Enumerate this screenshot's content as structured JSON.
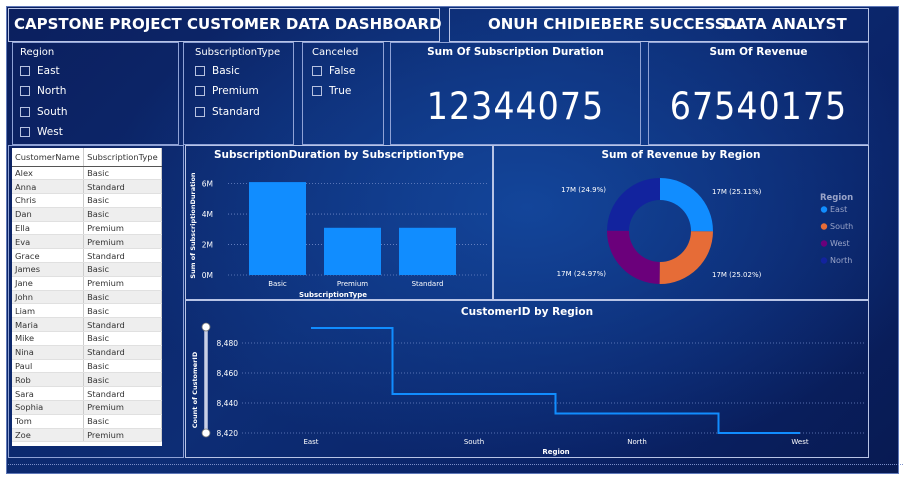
{
  "header": {
    "title": "CAPSTONE PROJECT CUSTOMER DATA DASHBOARD",
    "author": "ONUH CHIDIEBERE SUCCESS....",
    "role": "DATA ANALYST"
  },
  "slicers": {
    "region": {
      "title": "Region",
      "options": [
        "East",
        "North",
        "South",
        "West"
      ]
    },
    "subscription": {
      "title": "SubscriptionType",
      "options": [
        "Basic",
        "Premium",
        "Standard"
      ]
    },
    "canceled": {
      "title": "Canceled",
      "options": [
        "False",
        "True"
      ]
    }
  },
  "kpis": {
    "duration": {
      "title": "Sum Of Subscription Duration",
      "value": "12344075"
    },
    "revenue": {
      "title": "Sum Of Revenue",
      "value": "67540175"
    }
  },
  "table": {
    "columns": [
      "CustomerName",
      "SubscriptionType"
    ],
    "rows": [
      [
        "Alex",
        "Basic"
      ],
      [
        "Anna",
        "Standard"
      ],
      [
        "Chris",
        "Basic"
      ],
      [
        "Dan",
        "Basic"
      ],
      [
        "Ella",
        "Premium"
      ],
      [
        "Eva",
        "Premium"
      ],
      [
        "Grace",
        "Standard"
      ],
      [
        "James",
        "Basic"
      ],
      [
        "Jane",
        "Premium"
      ],
      [
        "John",
        "Basic"
      ],
      [
        "Liam",
        "Basic"
      ],
      [
        "Maria",
        "Standard"
      ],
      [
        "Mike",
        "Basic"
      ],
      [
        "Nina",
        "Standard"
      ],
      [
        "Paul",
        "Basic"
      ],
      [
        "Rob",
        "Basic"
      ],
      [
        "Sara",
        "Standard"
      ],
      [
        "Sophia",
        "Premium"
      ],
      [
        "Tom",
        "Basic"
      ],
      [
        "Zoe",
        "Premium"
      ]
    ]
  },
  "chart_data": [
    {
      "type": "bar",
      "title": "SubscriptionDuration by SubscriptionType",
      "xlabel": "SubscriptionType",
      "ylabel": "Sum of SubscriptionDuration",
      "categories": [
        "Basic",
        "Premium",
        "Standard"
      ],
      "values": [
        6.1,
        3.1,
        3.1
      ],
      "unit": "M",
      "yticks": [
        "0M",
        "2M",
        "4M",
        "6M"
      ],
      "ylim": [
        0,
        6.5
      ],
      "color": "#118dff"
    },
    {
      "type": "pie",
      "title": "Sum of Revenue by Region",
      "legend_title": "Region",
      "legend_position": "right",
      "categories": [
        "East",
        "South",
        "West",
        "North"
      ],
      "values": [
        25.11,
        25.02,
        24.97,
        24.9
      ],
      "labels": [
        "17M (25.11%)",
        "17M (25.02%)",
        "17M (24.97%)",
        "17M (24.9%)"
      ],
      "colors": [
        "#118dff",
        "#e66c37",
        "#6b007b",
        "#12239e"
      ]
    },
    {
      "type": "line",
      "title": "CustomerID by Region",
      "xlabel": "Region",
      "ylabel": "Count of CustomerID",
      "categories": [
        "East",
        "South",
        "North",
        "West"
      ],
      "values": [
        8490,
        8446,
        8433,
        8420
      ],
      "yticks": [
        "8,420",
        "8,440",
        "8,460",
        "8,480"
      ],
      "ylim": [
        8420,
        8480
      ],
      "color": "#118dff"
    }
  ]
}
